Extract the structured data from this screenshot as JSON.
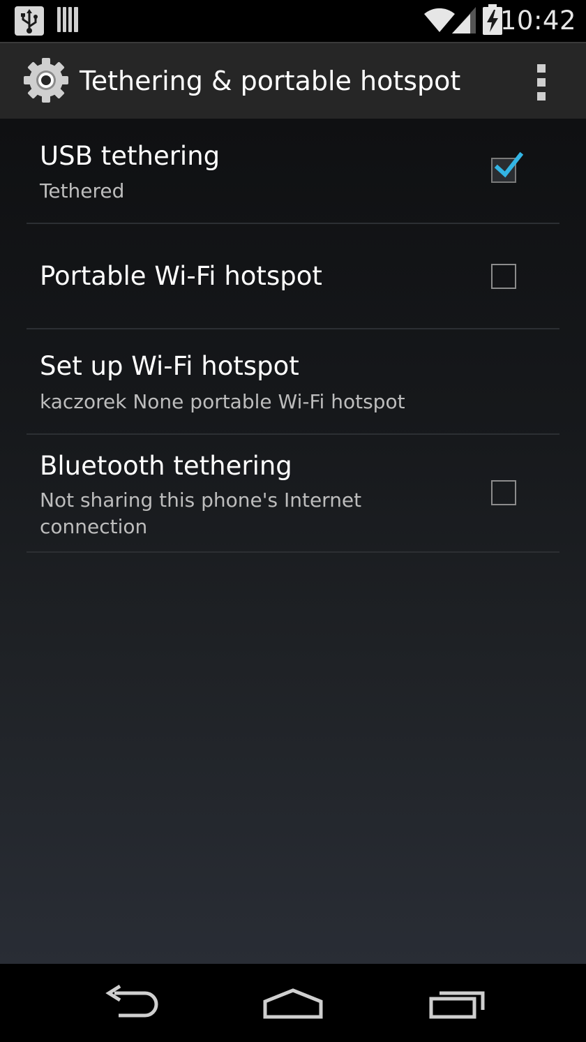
{
  "status_bar": {
    "time": "10:42",
    "icons": [
      "usb-debug-icon",
      "barcode-icon",
      "wifi-signal-icon",
      "cell-signal-icon",
      "battery-charging-icon"
    ]
  },
  "action_bar": {
    "title": "Tethering & portable hotspot",
    "icon": "settings-gear-icon",
    "overflow_icon": "overflow-menu-icon"
  },
  "preferences": [
    {
      "title": "USB tethering",
      "summary": "Tethered",
      "checkbox": true,
      "checked": true
    },
    {
      "title": "Portable Wi-Fi hotspot",
      "summary": "",
      "checkbox": true,
      "checked": false
    },
    {
      "title": "Set up Wi-Fi hotspot",
      "summary": "kaczorek None portable Wi-Fi hotspot",
      "checkbox": false
    },
    {
      "title": "Bluetooth tethering",
      "summary_line1": "Not sharing this phone's Internet",
      "summary_line2": "connection",
      "checkbox": true,
      "checked": false
    }
  ],
  "nav_bar": {
    "icons": [
      "back-icon",
      "home-icon",
      "recent-apps-icon"
    ]
  },
  "colors": {
    "accent": "#33b5e5",
    "action_bar_bg": "#262626",
    "divider": "#2c2f33"
  }
}
